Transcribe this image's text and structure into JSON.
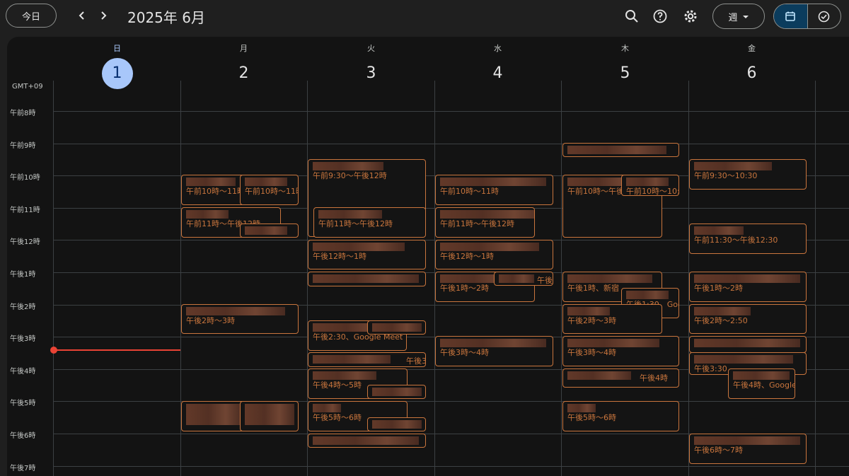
{
  "header": {
    "today_label": "今日",
    "prev_icon": "chevron-left-icon",
    "next_icon": "chevron-right-icon",
    "title": "2025年 6月",
    "view_label": "週",
    "icons": [
      "search-icon",
      "help-icon",
      "gear-icon",
      "calendar-icon",
      "tasks-icon"
    ]
  },
  "timezone": "GMT+09",
  "days": [
    {
      "dow": "日",
      "num": "1",
      "today": true
    },
    {
      "dow": "月",
      "num": "2"
    },
    {
      "dow": "火",
      "num": "3"
    },
    {
      "dow": "水",
      "num": "4"
    },
    {
      "dow": "木",
      "num": "5"
    },
    {
      "dow": "金",
      "num": "6"
    }
  ],
  "hours": [
    "午前8時",
    "午前9時",
    "午前10時",
    "午前11時",
    "午後12時",
    "午後1時",
    "午後2時",
    "午後3時",
    "午後4時",
    "午後5時",
    "午後6時",
    "午後7時"
  ],
  "events": [
    {
      "time": "午前10時～11時"
    },
    {
      "time": "午前10時～11時"
    },
    {
      "time": "午前11時～午後12時"
    },
    {
      "time": ""
    },
    {
      "time": "午後2時～3時"
    },
    {
      "time": ""
    },
    {
      "time": ""
    },
    {
      "time": "午前9:30～午後12時"
    },
    {
      "time": "午前11時～午後12時"
    },
    {
      "time": "午後12時～1時"
    },
    {
      "time": ""
    },
    {
      "time": "午後2:30、Google Meet"
    },
    {
      "time": ""
    },
    {
      "time": "午後3"
    },
    {
      "time": "午後4時～5時"
    },
    {
      "time": ""
    },
    {
      "time": "午後5時～6時"
    },
    {
      "time": ""
    },
    {
      "time": ""
    },
    {
      "time": "午前10時～11時"
    },
    {
      "time": "午前11時～午後12時"
    },
    {
      "time": "午後12時～1時"
    },
    {
      "time": "午後1時～2時"
    },
    {
      "time": "午後"
    },
    {
      "time": "午後3時～4時"
    },
    {
      "time": ""
    },
    {
      "time": "午前10時～午後"
    },
    {
      "time": "午前10時～10:"
    },
    {
      "time": "午後1時、新宿"
    },
    {
      "time": "午後1:30、Goo"
    },
    {
      "time": "午後2時～3時"
    },
    {
      "time": "午後3時～4時"
    },
    {
      "time": "午後4時"
    },
    {
      "time": "午後5時～6時"
    },
    {
      "time": "午前9:30～10:30"
    },
    {
      "time": "午前11:30～午後12:30"
    },
    {
      "time": "午後1時～2時"
    },
    {
      "time": "午後2時～2:50"
    },
    {
      "time": ""
    },
    {
      "time": "午後3:30"
    },
    {
      "time": "午後4時、Google"
    },
    {
      "time": "午後6時～7時"
    }
  ],
  "colors": {
    "accent": "#c9753d",
    "today": "#a8c7fa",
    "now": "#ea4335"
  }
}
